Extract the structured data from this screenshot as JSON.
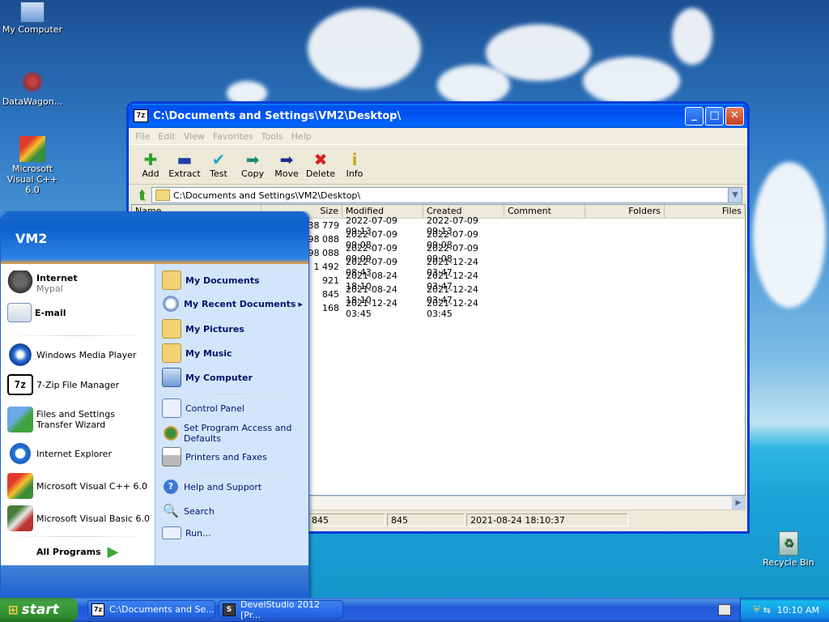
{
  "desktop": {
    "icons": [
      {
        "label": "My Computer",
        "icon": "computer-icon"
      },
      {
        "label": "DataWagon...",
        "icon": "datawagon-icon"
      },
      {
        "label": "Microsoft Visual C++ 6.0",
        "icon": "visual-cpp-icon"
      },
      {
        "label": "Recycle Bin",
        "icon": "recycle-bin-icon"
      }
    ]
  },
  "window": {
    "title": "C:\\Documents and Settings\\VM2\\Desktop\\",
    "title_icon": "7z",
    "menu": [
      "File",
      "Edit",
      "View",
      "Favorites",
      "Tools",
      "Help"
    ],
    "toolbar": [
      {
        "label": "Add",
        "icon": "add-icon"
      },
      {
        "label": "Extract",
        "icon": "extract-icon"
      },
      {
        "label": "Test",
        "icon": "test-icon"
      },
      {
        "label": "Copy",
        "icon": "copy-icon"
      },
      {
        "label": "Move",
        "icon": "move-icon"
      },
      {
        "label": "Delete",
        "icon": "delete-icon"
      },
      {
        "label": "Info",
        "icon": "info-icon"
      }
    ],
    "address": "C:\\Documents and Settings\\VM2\\Desktop\\",
    "columns": [
      "Name",
      "Size",
      "Modified",
      "Created",
      "Comment",
      "Folders",
      "Files"
    ],
    "rows": [
      {
        "size": "338 779",
        "modified": "2022-07-09 09:13",
        "created": "2022-07-09 09:13"
      },
      {
        "size": "498 088",
        "modified": "2022-07-09 09:08",
        "created": "2022-07-09 09:08"
      },
      {
        "size": "498 088",
        "modified": "2022-07-09 09:09",
        "created": "2022-07-09 09:08"
      },
      {
        "size": "1 492",
        "modified": "2022-07-09 08:43",
        "created": "2021-12-24 03:47"
      },
      {
        "size": "921",
        "modified": "2021-08-24 18:10",
        "created": "2021-12-24 03:47"
      },
      {
        "size": "845",
        "modified": "2021-08-24 18:10",
        "created": "2021-12-24 03:47"
      },
      {
        "size": "168",
        "modified": "2021-12-24 03:45",
        "created": "2021-12-24 03:45"
      }
    ],
    "status": [
      "845",
      "845",
      "2021-08-24 18:10:37"
    ]
  },
  "start_menu": {
    "user": "VM2",
    "pinned": [
      {
        "label": "Internet",
        "sub": "Mypal"
      },
      {
        "label": "E-mail"
      }
    ],
    "recent": [
      "Windows Media Player",
      "7-Zip File Manager",
      "Files and Settings Transfer Wizard",
      "Internet Explorer",
      "Microsoft Visual C++ 6.0",
      "Microsoft Visual Basic 6.0"
    ],
    "all_programs": "All Programs",
    "right": {
      "places": [
        "My Documents",
        "My Recent Documents",
        "My Pictures",
        "My Music",
        "My Computer"
      ],
      "settings": [
        "Control Panel",
        "Set Program Access and Defaults",
        "Printers and Faxes"
      ],
      "tools": [
        "Help and Support",
        "Search",
        "Run..."
      ]
    }
  },
  "taskbar": {
    "start": "start",
    "items": [
      "C:\\Documents and Se...",
      "DevelStudio 2012 [Pr..."
    ],
    "clock": "10:10 AM"
  }
}
